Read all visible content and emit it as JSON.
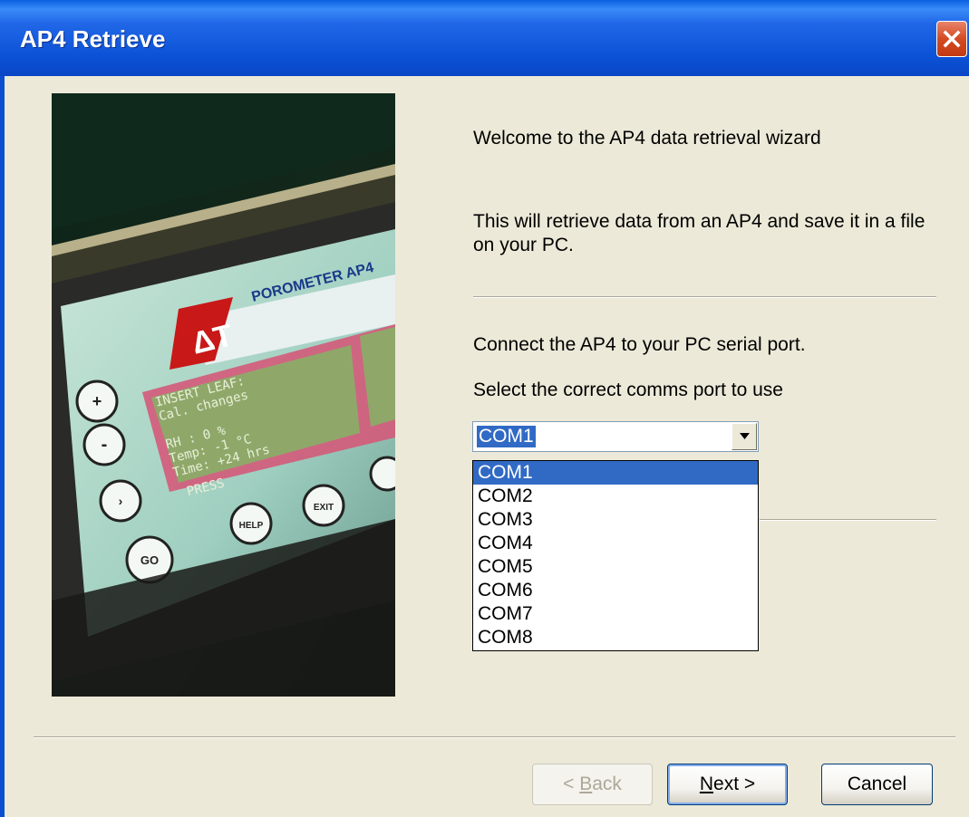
{
  "window": {
    "title": "AP4 Retrieve"
  },
  "photo": {
    "brand": "ΔT",
    "device_label": "POROMETER AP4",
    "screen_lines": [
      "INSERT LEAF:",
      "Cal. changes",
      "",
      "RH :   0 %",
      "Temp: -1 °C",
      "Time: +24 hrs"
    ],
    "screen_bottom": "PRESS",
    "button_plus": "+",
    "button_minus": "-",
    "button_go": "GO",
    "button_help": "HELP",
    "button_exit": "EXIT"
  },
  "wizard": {
    "welcome": "Welcome to the AP4 data retrieval wizard",
    "description": "This will retrieve data from an AP4 and save it in a file on your PC.",
    "connect": "Connect the AP4 to your PC serial port.",
    "select": "Select the correct comms port to use"
  },
  "combo": {
    "value": "COM1",
    "options": [
      "COM1",
      "COM2",
      "COM3",
      "COM4",
      "COM5",
      "COM6",
      "COM7",
      "COM8"
    ]
  },
  "buttons": {
    "back": {
      "pre": "< ",
      "accel": "B",
      "post": "ack"
    },
    "next": {
      "pre": "",
      "accel": "N",
      "post": "ext >"
    },
    "cancel": "Cancel"
  }
}
